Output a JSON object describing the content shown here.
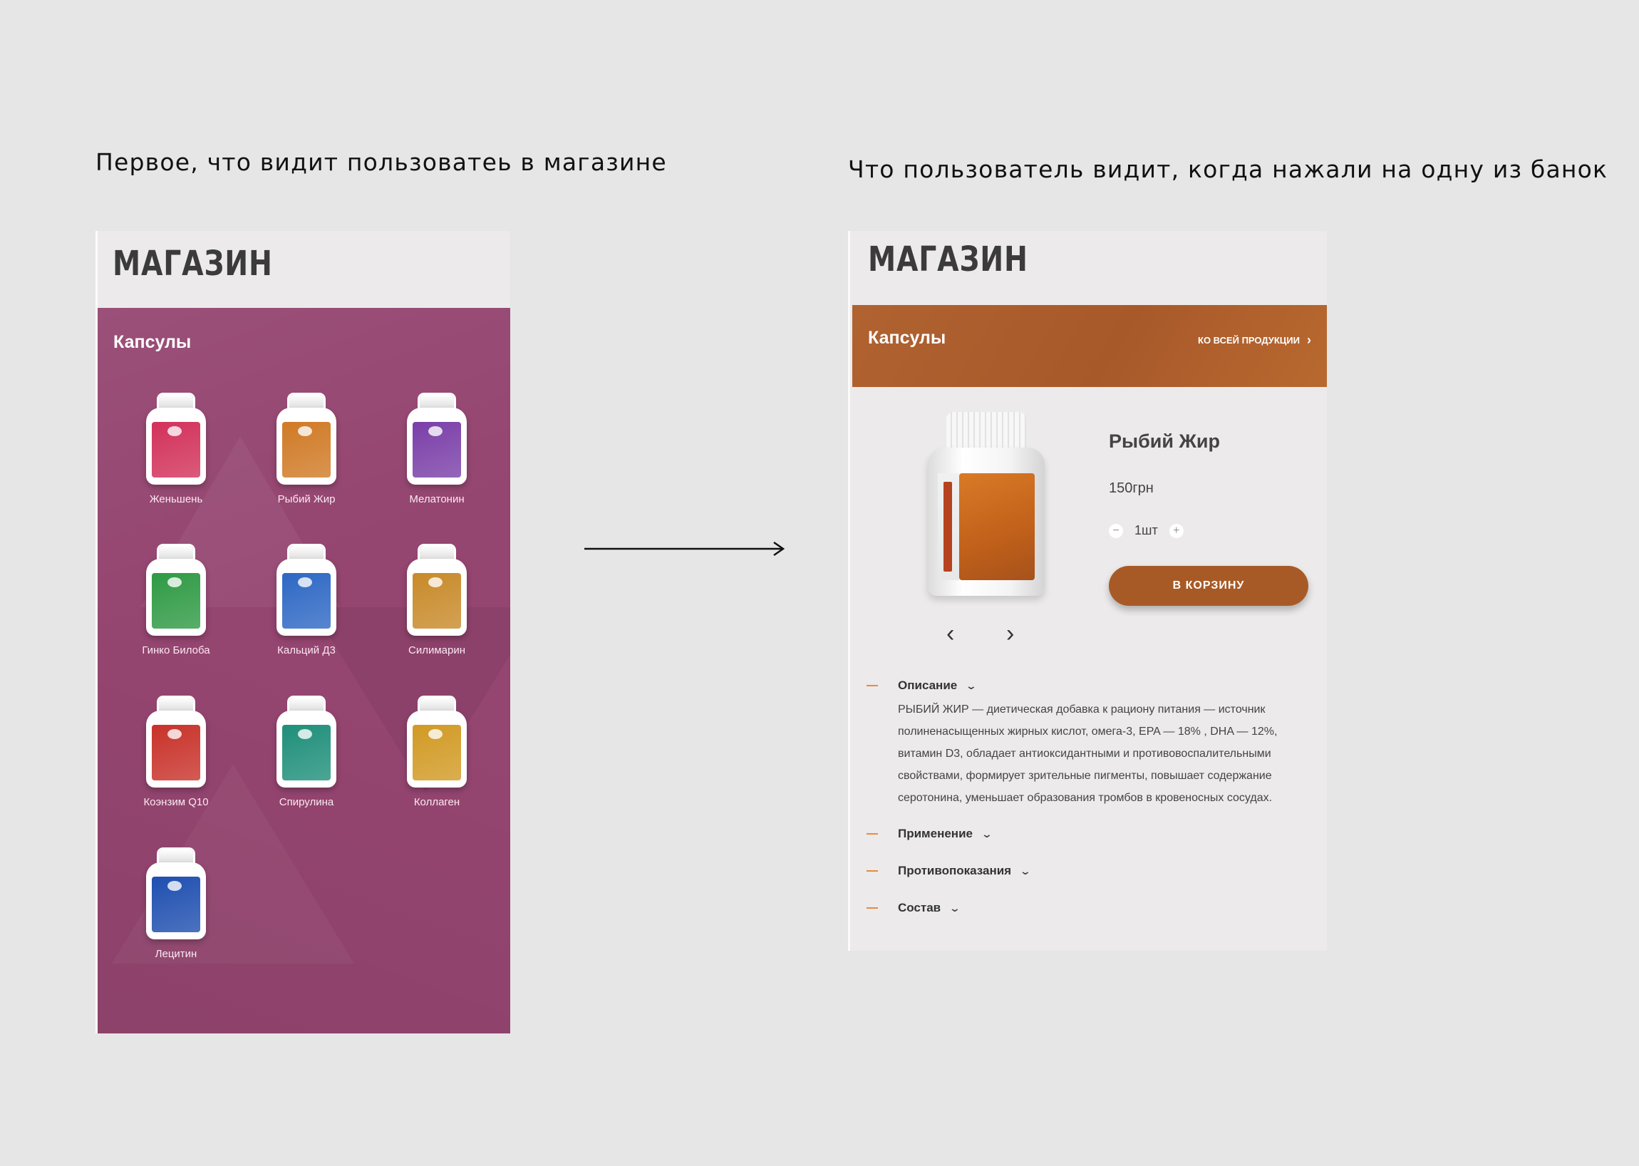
{
  "captions": {
    "left": "Первое, что видит пользоватеь в магазине",
    "right": "Что пользователь видит, когда нажали на одну из банок"
  },
  "shop_list": {
    "title": "МАГАЗИН",
    "category": "Капсулы",
    "products": [
      {
        "label": "Женьшень",
        "color": "#d2315a"
      },
      {
        "label": "Рыбий Жир",
        "color": "#d07a25"
      },
      {
        "label": "Мелатонин",
        "color": "#7a3fa8"
      },
      {
        "label": "Гинко Билоба",
        "color": "#2f9a44"
      },
      {
        "label": "Кальций Д3",
        "color": "#2e68c4"
      },
      {
        "label": "Силимарин",
        "color": "#c88a2a"
      },
      {
        "label": "Коэнзим Q10",
        "color": "#c8322a"
      },
      {
        "label": "Спирулина",
        "color": "#1f8f7a"
      },
      {
        "label": "Коллаген",
        "color": "#d19a24"
      },
      {
        "label": "Лецитин",
        "color": "#1f4fb0"
      }
    ]
  },
  "product_view": {
    "title": "МАГАЗИН",
    "category": "Капсулы",
    "back_link": "КО ВСЕЙ ПРОДУКЦИИ",
    "name": "Рыбий Жир",
    "price": "150грн",
    "quantity": "1шт",
    "qty_minus": "−",
    "qty_plus": "+",
    "cart_button": "В КОРЗИНУ",
    "prev": "‹",
    "next": "›",
    "sections": [
      {
        "title": "Описание",
        "text": "РЫБИЙ ЖИР — диетическая добавка к рациону питания — источник полиненасыщенных жирных кислот, омега-3, EPA — 18% , DHA — 12%, витамин D3, обладает антиоксидантными и противовоспалительными свойствами, формирует зрительные пигменты, повышает содержание серотонина, уменьшает образования тромбов в кровеносных сосудах."
      },
      {
        "title": "Применение"
      },
      {
        "title": "Противопоказания"
      },
      {
        "title": "Состав"
      }
    ]
  },
  "colors": {
    "catalog_bg": "#944570",
    "category_bar": "#a85a26",
    "cart_button": "#a85a26",
    "accent_dash": "#e88b3e",
    "page_bg": "#e6e6e6"
  }
}
